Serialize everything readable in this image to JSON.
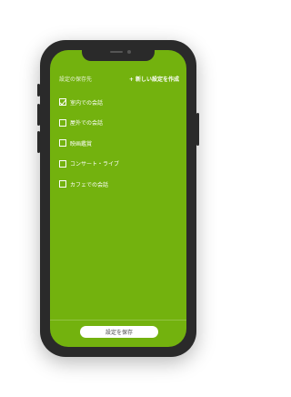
{
  "header": {
    "save_target_label": "設定の保存先",
    "new_setting_label": "+ 新しい設定を作成"
  },
  "settings": [
    {
      "label": "室内での会話",
      "checked": true
    },
    {
      "label": "屋外での会話",
      "checked": false
    },
    {
      "label": "映画鑑賞",
      "checked": false
    },
    {
      "label": "コンサート・ライブ",
      "checked": false
    },
    {
      "label": "カフェでの会話",
      "checked": false
    }
  ],
  "footer": {
    "save_button_label": "設定を保存"
  },
  "colors": {
    "screen_background": "#73b20e",
    "phone_frame": "#2a2a2a",
    "text": "#ffffff"
  }
}
